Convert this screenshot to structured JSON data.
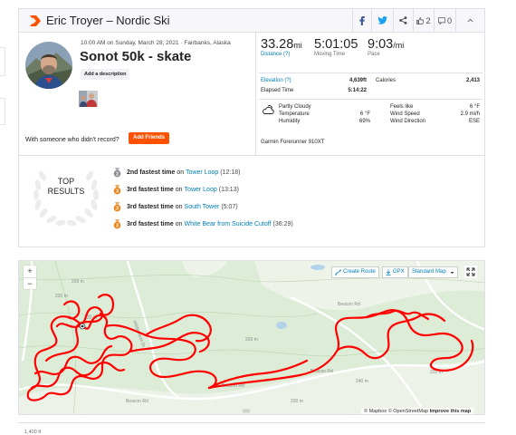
{
  "header": {
    "title": "Eric Troyer – Nordic Ski",
    "kudos_count": "2",
    "comment_count": "0"
  },
  "activity": {
    "date_line": "10:00 AM on Sunday, March 28, 2021 · Fairbanks, Alaska",
    "title": "Sonot 50k - skate",
    "add_description_label": "Add a description",
    "with_someone_text": "With someone who didn't record?",
    "add_friends_label": "Add Friends"
  },
  "stats": {
    "distance": {
      "value": "33.28",
      "unit": "mi",
      "label": "Distance (?)"
    },
    "moving_time": {
      "value": "5:01:05",
      "label": "Moving Time"
    },
    "pace": {
      "value": "9:03",
      "unit": "/mi",
      "label": "Pace"
    },
    "elevation_label": "Elevation (?)",
    "elevation_value": "4,639ft",
    "calories_label": "Calories",
    "calories_value": "2,413",
    "elapsed_label": "Elapsed Time",
    "elapsed_value": "5:14:22"
  },
  "weather": {
    "condition": "Partly Cloudy",
    "temperature_label": "Temperature",
    "temperature_value": "6 °F",
    "humidity_label": "Humidity",
    "humidity_value": "69%",
    "feels_like_label": "Feels like",
    "feels_like_value": "6 °F",
    "wind_speed_label": "Wind Speed",
    "wind_speed_value": "2.9 mi/h",
    "wind_direction_label": "Wind Direction",
    "wind_direction_value": "ESE"
  },
  "device": "Garmin Forerunner 910XT",
  "achievements": {
    "title_line1": "TOP",
    "title_line2": "RESULTS",
    "items": [
      {
        "rank": "2nd fastest time",
        "on": "on",
        "segment": "Tower Loop",
        "time": "(12:18)",
        "medal": "silver",
        "medal_num": "2"
      },
      {
        "rank": "3rd fastest time",
        "on": "on",
        "segment": "Tower Loop",
        "time": "(13:13)",
        "medal": "bronze",
        "medal_num": "3"
      },
      {
        "rank": "3rd fastest time",
        "on": "on",
        "segment": "South Tower",
        "time": "(5:07)",
        "medal": "bronze",
        "medal_num": "3"
      },
      {
        "rank": "3rd fastest time",
        "on": "on",
        "segment": "White Bear from Suicide Cutoff",
        "time": "(36:29)",
        "medal": "bronze",
        "medal_num": "3"
      }
    ]
  },
  "map": {
    "zoom_in": "+",
    "zoom_out": "−",
    "create_route": "Create Route",
    "gpx": "GPX",
    "map_style": "Standard Map",
    "attribution_mapbox": "© Mapbox",
    "attribution_osm": "© OpenStreetMap",
    "improve": "Improve this map",
    "road_labels": [
      "Beacon Rd",
      "Beacon Rd",
      "Beacon Rd",
      "Beacon Rd",
      "Wilderness Dr"
    ],
    "contour_labels": [
      "220 m",
      "220 m",
      "230 m",
      "240 m",
      "220 m",
      "220 m",
      "230 m",
      "220 m"
    ]
  },
  "elevation_chart": {
    "top_label": "1,400 ft"
  },
  "colors": {
    "brand": "#fc5200",
    "link": "#007fb6",
    "route": "#ff0000",
    "map_green": "#dcecd6"
  }
}
